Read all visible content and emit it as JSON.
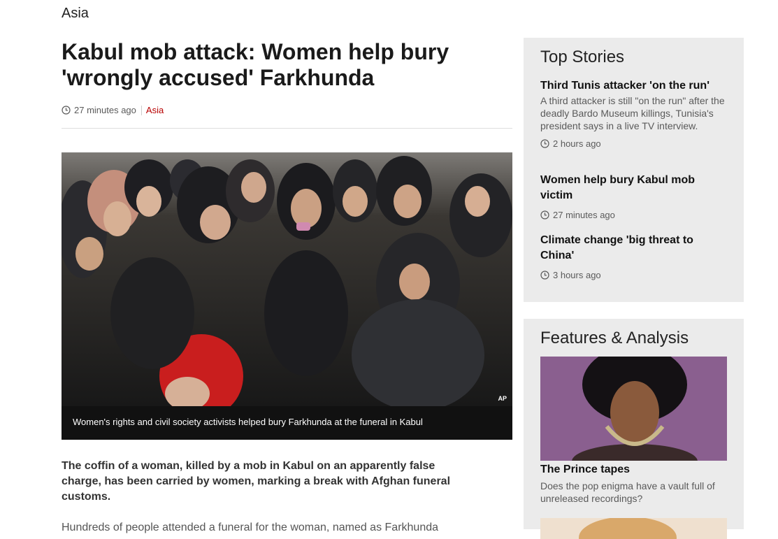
{
  "section": "Asia",
  "article": {
    "headline": "Kabul mob attack: Women help bury 'wrongly accused' Farkhunda",
    "timestamp": "27 minutes ago",
    "section_link": "Asia",
    "image_credit": "AP",
    "caption": "Women's rights and civil society activists helped bury Farkhunda at the funeral in Kabul",
    "intro": "The coffin of a woman, killed by a mob in Kabul on an apparently false charge, has been carried by women, marking a break with Afghan funeral customs.",
    "body": "Hundreds of people attended a funeral for the woman, named as Farkhunda"
  },
  "top_stories": {
    "title": "Top Stories",
    "items": [
      {
        "title": "Third Tunis attacker 'on the run'",
        "summary": "A third attacker is still \"on the run\" after the deadly Bardo Museum killings, Tunisia's president says in a live TV interview.",
        "time": "2 hours ago"
      },
      {
        "title": "Women help bury Kabul mob victim",
        "summary": "",
        "time": "27 minutes ago"
      },
      {
        "title": "Climate change 'big threat to China'",
        "summary": "",
        "time": "3 hours ago"
      }
    ]
  },
  "features": {
    "title": "Features & Analysis",
    "items": [
      {
        "title": "The Prince tapes",
        "summary": "Does the pop enigma have a vault full of unreleased recordings?"
      }
    ]
  },
  "icons": {
    "clock": "clock-icon"
  },
  "colors": {
    "accent": "#b80000",
    "panel_bg": "#ebebeb"
  }
}
